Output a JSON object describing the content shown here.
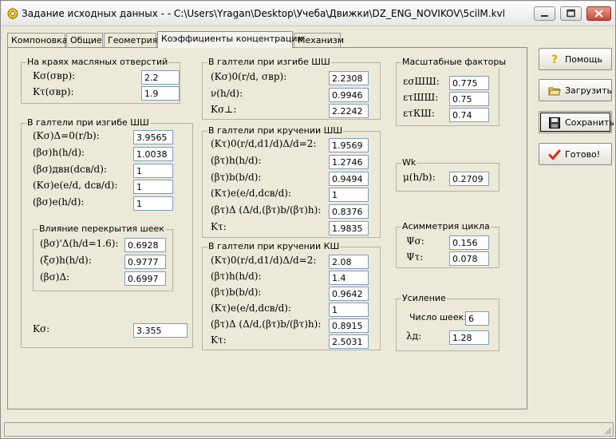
{
  "window": {
    "title": "Задание исходных данных -  - C:\\Users\\Yragan\\Desktop\\Учеба\\Движки\\DZ_ENG_NOVIKOV\\5cilM.kvl"
  },
  "tabs": [
    {
      "label": "Компоновка"
    },
    {
      "label": "Общие"
    },
    {
      "label": "Геометрия"
    },
    {
      "label": "Коэффициенты концентрации"
    },
    {
      "label": "Механизм"
    }
  ],
  "oil_holes": {
    "title": "На краях масляных отверстий",
    "rows": [
      {
        "label": "Kσ(σвр):",
        "value": "2.2"
      },
      {
        "label": "Kτ(σвр):",
        "value": "1.9"
      }
    ]
  },
  "journal_bending": {
    "title": "В галтели при изгибе ШШ",
    "rows": [
      {
        "label": "(Kσ)Δ=0(r/b):",
        "value": "3.9565"
      },
      {
        "label": "(βσ)h(h/d):",
        "value": "1.0038"
      },
      {
        "label": "(βσ)двн(dсв/d):",
        "value": "1"
      },
      {
        "label": "(Kσ)e(e/d, dсв/d):",
        "value": "1"
      },
      {
        "label": "(βσ)e(h/d):",
        "value": "1"
      }
    ],
    "overlap": {
      "title": "Влияние перекрытия шеек",
      "rows": [
        {
          "label": "(βσ)'Δ(h/d=1.6):",
          "value": "0.6928"
        },
        {
          "label": "(ξσ)h(h/d):",
          "value": "0.9777"
        },
        {
          "label": "(βσ)Δ:",
          "value": "0.6997"
        }
      ]
    },
    "total": {
      "label": "Kσ:",
      "value": "3.355"
    }
  },
  "fillet_bending": {
    "title": "В галтели при изгибе ШШ",
    "rows": [
      {
        "label": "(Kσ)0(r/d, σвр):",
        "value": "2.2308"
      },
      {
        "label": "ν(h/d):",
        "value": "0.9946"
      },
      {
        "label": "Kσ⊥:",
        "value": "2.2242"
      }
    ]
  },
  "fillet_torsion_shsh": {
    "title": "В галтели при кручении ШШ",
    "rows": [
      {
        "label": "(Kτ)0(r/d,d1/d)Δ/d=2:",
        "value": "1.9569"
      },
      {
        "label": "(βτ)h(h/d):",
        "value": "1.2746"
      },
      {
        "label": "(βτ)b(b/d):",
        "value": "0.9494"
      },
      {
        "label": "(Kτ)e(e/d,dсв/d):",
        "value": "1"
      },
      {
        "label": "(βτ)Δ (Δ/d,(βτ)b/(βτ)h):",
        "value": "0.8376"
      },
      {
        "label": "Kτ:",
        "value": "1.9835"
      }
    ]
  },
  "fillet_torsion_ksh": {
    "title": "В галтели при кручении КШ",
    "rows": [
      {
        "label": "(Kτ)0(r/d,d1/d)Δ/d=2:",
        "value": "2.08"
      },
      {
        "label": "(βτ)h(h/d):",
        "value": "1.4"
      },
      {
        "label": "(βτ)b(b/d):",
        "value": "0.9642"
      },
      {
        "label": "(Kτ)e(e/d,dсв/d):",
        "value": "1"
      },
      {
        "label": "(βτ)Δ (Δ/d,(βτ)b/(βτ)h):",
        "value": "0.8915"
      },
      {
        "label": "Kτ:",
        "value": "2.5031"
      }
    ]
  },
  "scale_factors": {
    "title": "Масштабные факторы",
    "rows": [
      {
        "label": "εσШШ:",
        "value": "0.775"
      },
      {
        "label": "ετШШ:",
        "value": "0.75"
      },
      {
        "label": "ετКШ:",
        "value": "0.74"
      }
    ]
  },
  "wk": {
    "title": "Wk",
    "label": "μ(h/b):",
    "value": "0.2709"
  },
  "asymmetry": {
    "title": "Асимметрия цикла",
    "rows": [
      {
        "label": "Ψσ:",
        "value": "0.156"
      },
      {
        "label": "Ψτ:",
        "value": "0.078"
      }
    ]
  },
  "reinforcement": {
    "title": "Усиление",
    "count_label": "Число шеек:",
    "count_value": "6",
    "lambda_label": "λд:",
    "lambda_value": "1.28"
  },
  "buttons": {
    "help": "Помощь",
    "load": "Загрузить",
    "save": "Сохранить",
    "done": "Готово!"
  },
  "colors": {
    "panel_bg": "#ece9d8",
    "field_border": "#7f9db9",
    "done_icon": "#d6281e",
    "help_icon": "#e0a800"
  }
}
